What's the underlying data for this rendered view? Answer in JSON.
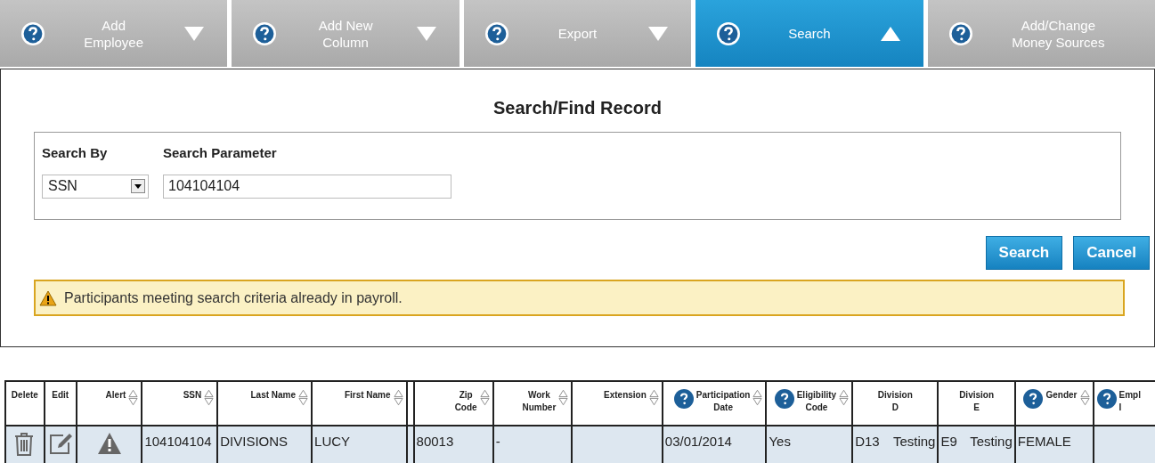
{
  "tabs": [
    {
      "label": "Add Employee",
      "kind": "dropdown",
      "selected": false,
      "expanded": false
    },
    {
      "label": "Add New Column",
      "kind": "dropdown",
      "selected": false,
      "expanded": false
    },
    {
      "label": "Export",
      "kind": "dropdown",
      "selected": false,
      "expanded": false
    },
    {
      "label": "Search",
      "kind": "dropdown",
      "selected": true,
      "expanded": true
    },
    {
      "label": "Add/Change Money Sources",
      "kind": "link",
      "selected": false
    }
  ],
  "search_panel": {
    "title": "Search/Find Record",
    "search_by": {
      "label": "Search By",
      "value": "SSN"
    },
    "search_parameter": {
      "label": "Search Parameter",
      "value": "104104104"
    },
    "buttons": [
      "Search",
      "Cancel"
    ],
    "warning": "Participants meeting search criteria already in payroll."
  },
  "table": {
    "columns": [
      {
        "lines": [
          "Delete"
        ],
        "sortable": false,
        "help": false
      },
      {
        "lines": [
          "Edit"
        ],
        "sortable": false,
        "help": false
      },
      {
        "lines": [
          "Alert"
        ],
        "sortable": true,
        "help": false
      },
      {
        "lines": [
          "SSN"
        ],
        "sortable": true,
        "help": false
      },
      {
        "lines": [
          "Last Name"
        ],
        "sortable": true,
        "help": false
      },
      {
        "lines": [
          "First Name"
        ],
        "sortable": true,
        "help": false
      },
      {
        "sortable": false,
        "help": false
      },
      {
        "lines": [
          "Zip",
          "Code"
        ],
        "sortable": true,
        "help": false
      },
      {
        "lines": [
          "Work",
          "Number"
        ],
        "sortable": true,
        "help": false
      },
      {
        "lines": [
          "Extension"
        ],
        "sortable": true,
        "help": false
      },
      {
        "lines": [
          "Participation",
          "Date"
        ],
        "sortable": true,
        "help": true
      },
      {
        "lines": [
          "Eligibility",
          "Code"
        ],
        "sortable": true,
        "help": true
      },
      {
        "lines": [
          "Division",
          "D"
        ],
        "sortable": false,
        "help": false
      },
      {
        "lines": [
          "Division",
          "E"
        ],
        "sortable": false,
        "help": false
      },
      {
        "lines": [
          "Gender"
        ],
        "sortable": true,
        "help": true
      },
      {
        "lines": [
          "Empl",
          "I"
        ],
        "sortable": false,
        "help": true
      }
    ],
    "rows": [
      {
        "cells": [
          {
            "kind": "delete"
          },
          {
            "kind": "edit"
          },
          {
            "kind": "alert"
          },
          {
            "kind": "text",
            "text": "104104104"
          },
          {
            "kind": "text",
            "text": "DIVISIONS"
          },
          {
            "kind": "text",
            "text": "LUCY"
          },
          {
            "kind": "empty"
          },
          {
            "kind": "text",
            "text": "80013"
          },
          {
            "kind": "text",
            "text": "-"
          },
          {
            "kind": "empty"
          },
          {
            "kind": "text",
            "text": "03/01/2014"
          },
          {
            "kind": "text",
            "text": "Yes"
          },
          {
            "kind": "pair",
            "text": "D13",
            "text2": "Testing"
          },
          {
            "kind": "pair",
            "text": "E9",
            "text2": "Testing"
          },
          {
            "kind": "text",
            "text": "FEMALE"
          },
          {
            "kind": "empty"
          }
        ]
      }
    ]
  }
}
